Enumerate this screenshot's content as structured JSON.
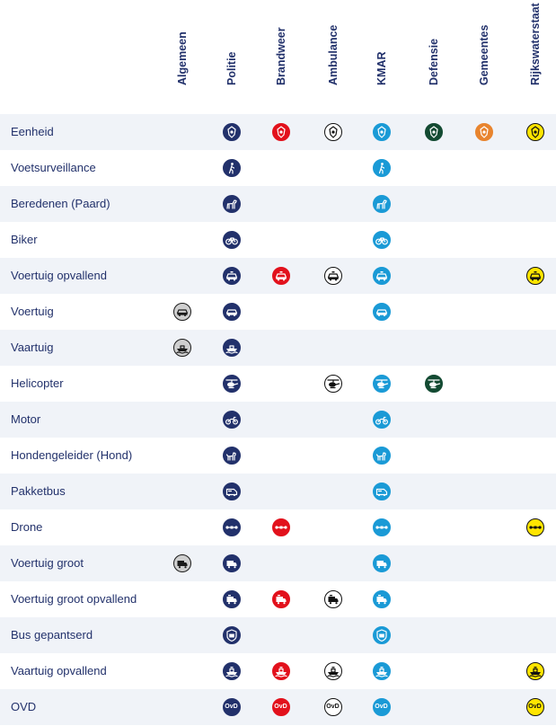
{
  "columns": [
    "Algemeen",
    "Politie",
    "Brandweer",
    "Ambulance",
    "KMAR",
    "Defensie",
    "Gemeentes",
    "Rijkswaterstaat"
  ],
  "column_colors": {
    "Algemeen": {
      "bg": "#cfcfcf",
      "fg": "#1a1a1a",
      "ring": "#1a1a1a"
    },
    "Politie": {
      "bg": "#22316b",
      "fg": "#ffffff",
      "ring": "#22316b"
    },
    "Brandweer": {
      "bg": "#e2111c",
      "fg": "#ffffff",
      "ring": "#e2111c"
    },
    "Ambulance": {
      "bg": "#ffffff",
      "fg": "#111111",
      "ring": "#111111"
    },
    "KMAR": {
      "bg": "#1a9ad6",
      "fg": "#ffffff",
      "ring": "#1a9ad6"
    },
    "Defensie": {
      "bg": "#134a32",
      "fg": "#ffffff",
      "ring": "#134a32"
    },
    "Gemeentes": {
      "bg": "#e8842e",
      "fg": "#ffffff",
      "ring": "#e8842e"
    },
    "Rijkswaterstaat": {
      "bg": "#ffe500",
      "fg": "#111111",
      "ring": "#111111"
    }
  },
  "ovd_text": "OvD",
  "rows": [
    {
      "label": "Eenheid",
      "icon": "badge-icon",
      "cols": [
        "Politie",
        "Brandweer",
        "Ambulance",
        "KMAR",
        "Defensie",
        "Gemeentes",
        "Rijkswaterstaat"
      ]
    },
    {
      "label": "Voetsurveillance",
      "icon": "walking-person-icon",
      "cols": [
        "Politie",
        "KMAR"
      ]
    },
    {
      "label": "Beredenen (Paard)",
      "icon": "horse-icon",
      "cols": [
        "Politie",
        "KMAR"
      ]
    },
    {
      "label": "Biker",
      "icon": "bicycle-icon",
      "cols": [
        "Politie",
        "KMAR"
      ]
    },
    {
      "label": "Voertuig opvallend",
      "icon": "car-lightbar-icon",
      "cols": [
        "Politie",
        "Brandweer",
        "Ambulance",
        "KMAR",
        "Rijkswaterstaat"
      ]
    },
    {
      "label": "Voertuig",
      "icon": "car-icon",
      "cols": [
        "Algemeen",
        "Politie",
        "KMAR"
      ]
    },
    {
      "label": "Vaartuig",
      "icon": "boat-icon",
      "cols": [
        "Algemeen",
        "Politie"
      ]
    },
    {
      "label": "Helicopter",
      "icon": "helicopter-icon",
      "cols": [
        "Politie",
        "Ambulance",
        "KMAR",
        "Defensie"
      ]
    },
    {
      "label": "Motor",
      "icon": "motorcycle-icon",
      "cols": [
        "Politie",
        "KMAR"
      ]
    },
    {
      "label": "Hondengeleider (Hond)",
      "icon": "dog-icon",
      "cols": [
        "Politie",
        "KMAR"
      ]
    },
    {
      "label": "Pakketbus",
      "icon": "van-icon",
      "cols": [
        "Politie",
        "KMAR"
      ]
    },
    {
      "label": "Drone",
      "icon": "drone-icon",
      "cols": [
        "Politie",
        "Brandweer",
        "KMAR",
        "Rijkswaterstaat"
      ]
    },
    {
      "label": "Voertuig groot",
      "icon": "truck-icon",
      "cols": [
        "Algemeen",
        "Politie",
        "KMAR"
      ]
    },
    {
      "label": "Voertuig groot opvallend",
      "icon": "truck-lightbar-icon",
      "cols": [
        "Politie",
        "Brandweer",
        "Ambulance",
        "KMAR"
      ]
    },
    {
      "label": "Bus gepantserd",
      "icon": "armored-bus-icon",
      "cols": [
        "Politie",
        "KMAR"
      ]
    },
    {
      "label": "Vaartuig opvallend",
      "icon": "boat-lightbar-icon",
      "cols": [
        "Politie",
        "Brandweer",
        "Ambulance",
        "KMAR",
        "Rijkswaterstaat"
      ]
    },
    {
      "label": "OVD",
      "icon": "ovd-text-icon",
      "cols": [
        "Politie",
        "Brandweer",
        "Ambulance",
        "KMAR",
        "Rijkswaterstaat"
      ]
    }
  ]
}
